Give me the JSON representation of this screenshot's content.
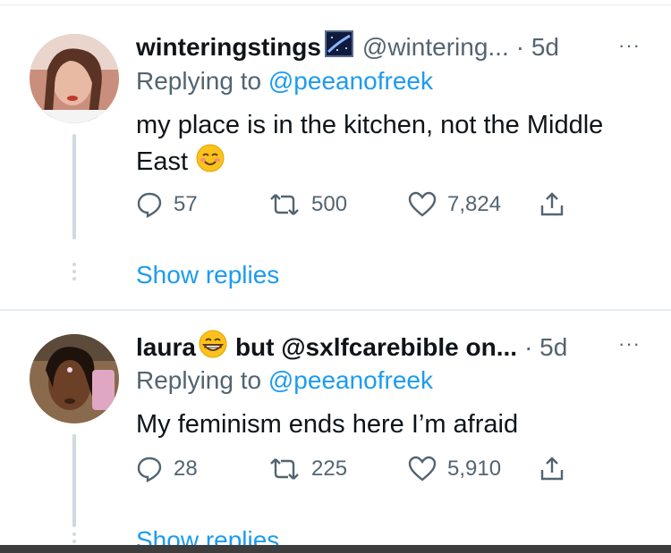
{
  "tweets": [
    {
      "name": "winteringstings",
      "handle": "@wintering...",
      "time": "· 5d",
      "more": "···",
      "replying_label": "Replying to",
      "replying_to": "@peeanofreek",
      "text": "my place is in the kitchen, not the Middle East",
      "emoji": "smiling-blush-emoji",
      "replies": "57",
      "retweets": "500",
      "likes": "7,824",
      "show_replies": "Show replies"
    },
    {
      "name": "laura",
      "name_suffix": "but @sxlfcarebible on...",
      "time": "· 5d",
      "more": "···",
      "replying_label": "Replying to",
      "replying_to": "@peeanofreek",
      "text": "My feminism ends here I’m afraid",
      "replies": "28",
      "retweets": "225",
      "likes": "5,910",
      "show_replies": "Show replies"
    }
  ],
  "colors": {
    "link": "#1d9bf0",
    "secondary": "#536471",
    "text": "#0f1419",
    "thread": "#cfd9de"
  }
}
